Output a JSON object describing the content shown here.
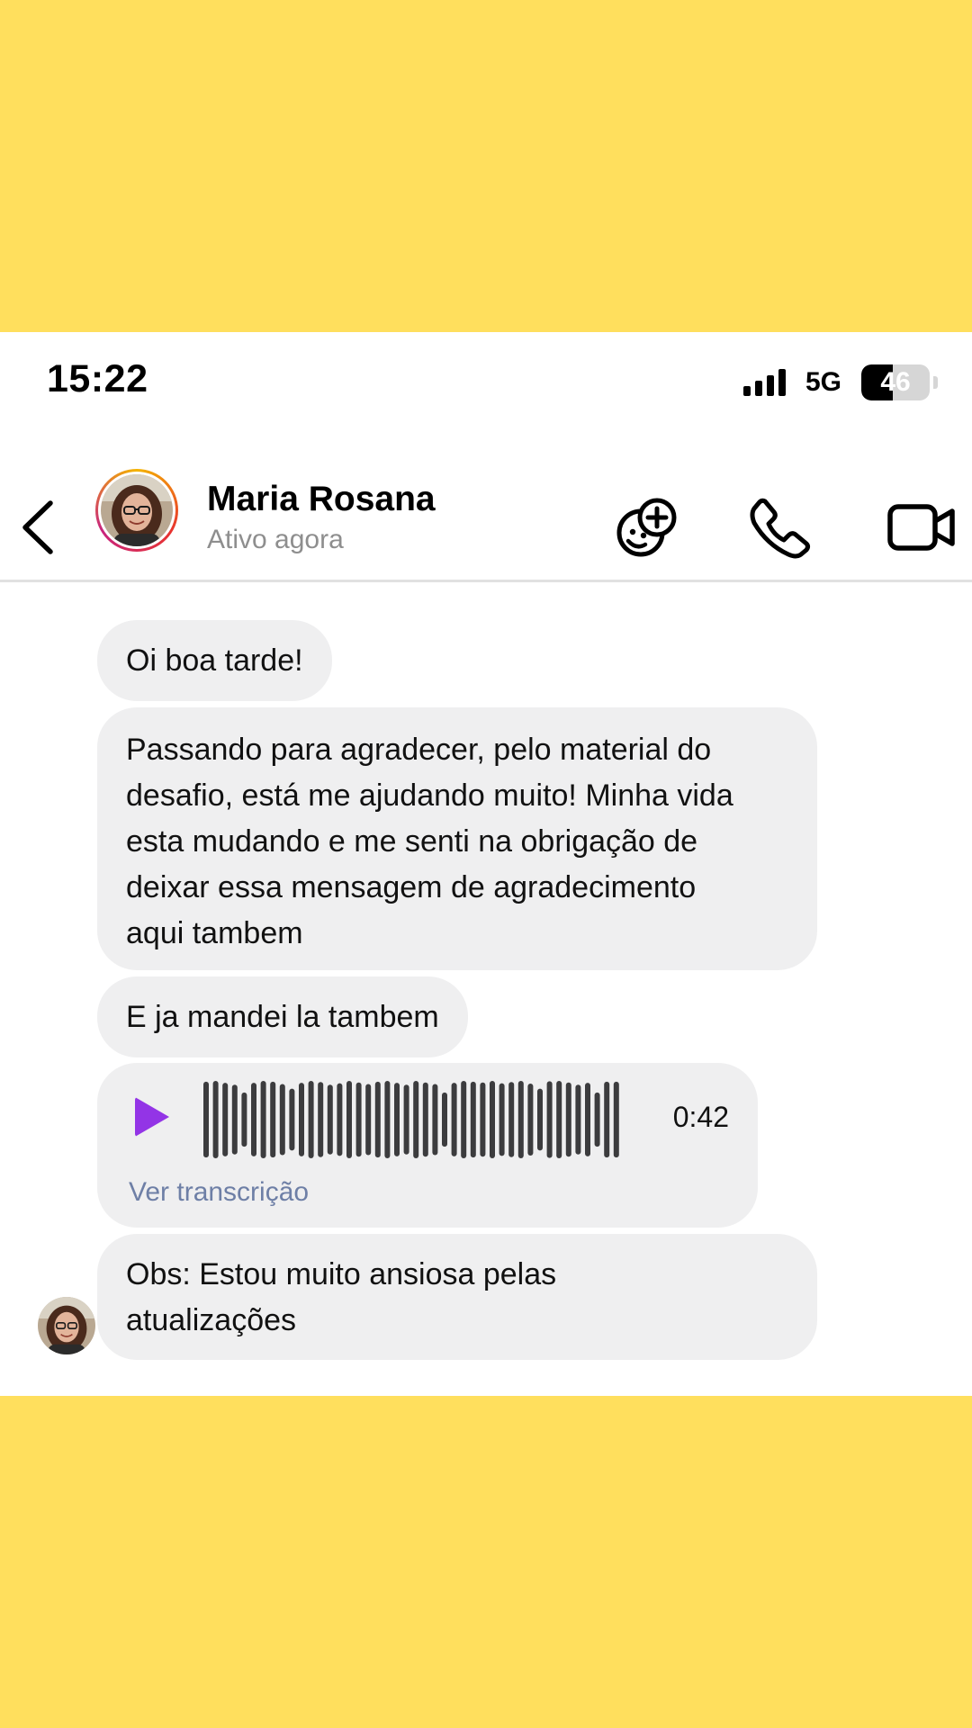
{
  "status_bar": {
    "time": "15:22",
    "network": "5G",
    "battery": "46",
    "battery_level": 0.46
  },
  "header": {
    "contact_name": "Maria Rosana",
    "contact_status": "Ativo agora",
    "icons": [
      "chevron-left-icon",
      "add-sticker-icon",
      "phone-icon",
      "video-camera-icon"
    ]
  },
  "messages": [
    {
      "type": "text",
      "text": "Oi boa tarde!"
    },
    {
      "type": "text",
      "lines": [
        "Passando para agradecer, pelo material do",
        "desafio, está me ajudando muito! Minha vida",
        "esta mudando e me senti na obrigação de",
        "deixar essa mensagem de agradecimento",
        "aqui tambem"
      ]
    },
    {
      "type": "text",
      "text": "E ja mandei la tambem"
    },
    {
      "type": "audio",
      "duration": "0:42",
      "transcript_link": "Ver transcrição"
    },
    {
      "type": "text",
      "lines": [
        "Obs: Estou muito ansiosa pelas",
        "atualizações"
      ]
    }
  ],
  "colors": {
    "background": "#FFDF5D",
    "bubble": "#EFEFF0",
    "play_button": "#9334E6",
    "link": "#6E7FA6",
    "muted_text": "#8E8E8E"
  }
}
